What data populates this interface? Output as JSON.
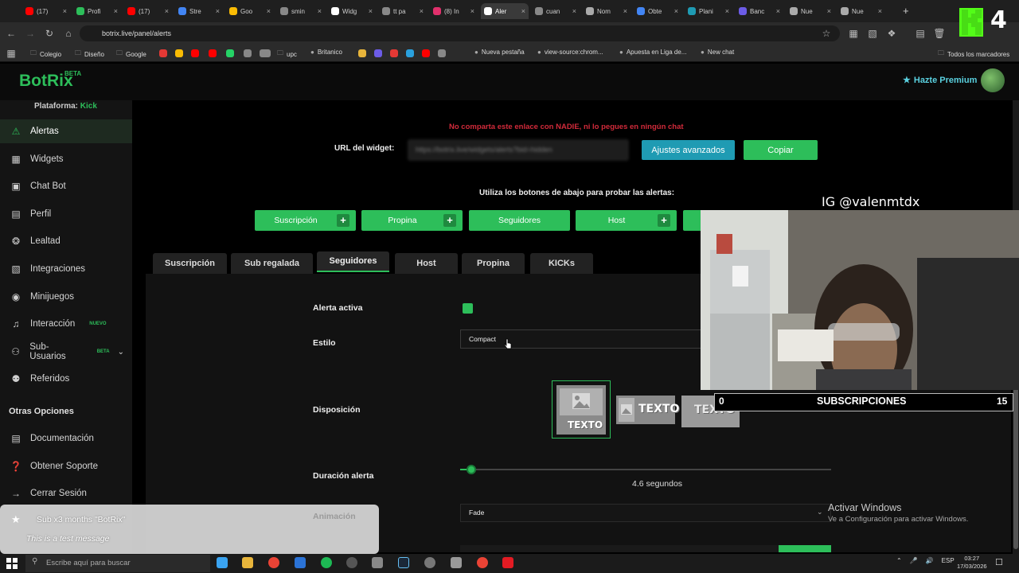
{
  "browser": {
    "tabs": [
      {
        "label": "(17)",
        "color": "#ff0000"
      },
      {
        "label": "Profi",
        "color": "#2dbe5a"
      },
      {
        "label": "(17)",
        "color": "#ff0000"
      },
      {
        "label": "Stre",
        "color": "#4285f4"
      },
      {
        "label": "Goo",
        "color": "#fbbc04"
      },
      {
        "label": "smin",
        "color": "#888888"
      },
      {
        "label": "Widg",
        "color": "#ffffff"
      },
      {
        "label": "tt pa",
        "color": "#888888"
      },
      {
        "label": "(8) In",
        "color": "#e1306c"
      },
      {
        "label": "Aler",
        "color": "#ffffff"
      },
      {
        "label": "cuan",
        "color": "#888888"
      },
      {
        "label": "Nom",
        "color": "#aaaaaa"
      },
      {
        "label": "Obte",
        "color": "#4285f4"
      },
      {
        "label": "Plani",
        "color": "#1f9bb3"
      },
      {
        "label": "Banc",
        "color": "#6c5ce7"
      },
      {
        "label": "Nue",
        "color": "#aaaaaa"
      },
      {
        "label": "Nue",
        "color": "#aaaaaa"
      }
    ],
    "url": "botrix.live/panel/alerts",
    "bookmarks": [
      {
        "label": "Colegio",
        "folder": true
      },
      {
        "label": "Diseño",
        "folder": true
      },
      {
        "label": "Google",
        "folder": true
      },
      {
        "label": "upc",
        "folder": true
      },
      {
        "label": "Britanico",
        "folder": false
      },
      {
        "label": "Nueva pestaña",
        "folder": false
      },
      {
        "label": "view-source:chrom...",
        "folder": false
      },
      {
        "label": "Apuesta en Liga de...",
        "folder": false
      },
      {
        "label": "New chat",
        "folder": false
      },
      {
        "label": "Todos los marcadores",
        "folder": true
      }
    ]
  },
  "app": {
    "logo": "BotRix",
    "logo_badge": "BETA",
    "premium_label": "Hazte Premium",
    "accent": "#2dbe5a"
  },
  "sidebar": {
    "platform_label": "Plataforma:",
    "platform_value": "Kick",
    "items": [
      {
        "label": "Alertas",
        "icon": "warning-icon",
        "active": true
      },
      {
        "label": "Widgets",
        "icon": "widgets-icon"
      },
      {
        "label": "Chat Bot",
        "icon": "chat-icon"
      },
      {
        "label": "Perfil",
        "icon": "profile-icon"
      },
      {
        "label": "Lealtad",
        "icon": "trophy-icon"
      },
      {
        "label": "Integraciones",
        "icon": "integrations-icon"
      },
      {
        "label": "Minijuegos",
        "icon": "gamepad-icon"
      },
      {
        "label": "Interacción",
        "icon": "music-icon",
        "badge": "NUEVO"
      },
      {
        "label": "Sub-Usuarios",
        "icon": "users-icon",
        "badge": "BETA"
      },
      {
        "label": "Referidos",
        "icon": "referral-icon"
      }
    ],
    "other_section": "Otras Opciones",
    "other_items": [
      {
        "label": "Documentación",
        "icon": "docs-icon"
      },
      {
        "label": "Obtener Soporte",
        "icon": "support-icon"
      },
      {
        "label": "Cerrar Sesión",
        "icon": "logout-icon"
      }
    ]
  },
  "main": {
    "warning": "No comparta este enlace con NADIE, ni lo pegues en ningún chat",
    "url_label": "URL del widget:",
    "url_value": "https://botrix.live/widgets/alerts?bid=hidden",
    "advanced_button": "Ajustes avanzados",
    "copy_button": "Copiar",
    "test_label": "Utiliza los botones de abajo para probar las alertas:",
    "test_buttons": [
      {
        "label": "Suscripción",
        "plus": true
      },
      {
        "label": "Propina",
        "plus": true
      },
      {
        "label": "Seguidores",
        "plus": false
      },
      {
        "label": "Host",
        "plus": true
      }
    ],
    "type_tabs": [
      "Suscripción",
      "Sub regalada",
      "Seguidores",
      "Host",
      "Propina",
      "KICKs"
    ],
    "active_tab": "Seguidores",
    "fields": {
      "active_label": "Alerta activa",
      "active_value": true,
      "style_label": "Estilo",
      "style_value": "Compact",
      "layout_label": "Disposición",
      "layout_text": "TEXTO",
      "duration_label": "Duración alerta",
      "duration_text": "4.6  segundos",
      "duration_fraction": 0.03,
      "animation_label": "Animación",
      "animation_value": "Fade"
    }
  },
  "overlay": {
    "ig_handle": "IG @valenmtdx",
    "kick_count": "4",
    "sub_bar_left": "0",
    "sub_bar_title": "SUBSCRIPCIONES",
    "sub_bar_right": "15",
    "toast_title": "Sub x3 months \"BotRix\"",
    "toast_message": "This is a test message"
  },
  "windows": {
    "activate_title": "Activar Windows",
    "activate_sub": "Ve a Configuración para activar Windows.",
    "search_placeholder": "Escribe aquí para buscar",
    "language": "ESP",
    "time": "03:27",
    "date": "17/03/2026"
  }
}
